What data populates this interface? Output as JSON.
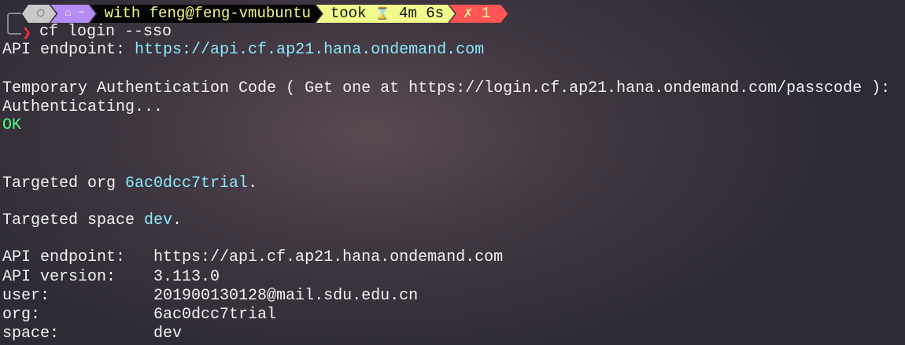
{
  "prompt": {
    "os_icon": "ubuntu-icon",
    "home_icon": "home-icon",
    "dir": "~",
    "user_host": "with feng@feng-vmubuntu",
    "took_label": "took",
    "hourglass_icon": "⌛",
    "duration": "4m 6s",
    "status_icon": "✗",
    "exit_code": "1",
    "chevron": "❯",
    "command": "cf login --sso"
  },
  "output": {
    "api_endpoint_label": "API endpoint: ",
    "api_endpoint_url": "https://api.cf.ap21.hana.ondemand.com",
    "temp_auth": "Temporary Authentication Code ( Get one at https://login.cf.ap21.hana.ondemand.com/passcode ):",
    "authenticating": "Authenticating...",
    "ok": "OK",
    "targeted_org_label": "Targeted org ",
    "targeted_org_value": "6ac0dcc7trial",
    "targeted_space_label": "Targeted space ",
    "targeted_space_value": "dev",
    "period": "."
  },
  "summary": [
    {
      "label": "API endpoint:   ",
      "value": "https://api.cf.ap21.hana.ondemand.com"
    },
    {
      "label": "API version:    ",
      "value": "3.113.0"
    },
    {
      "label": "user:           ",
      "value": "201900130128@mail.sdu.edu.cn"
    },
    {
      "label": "org:            ",
      "value": "6ac0dcc7trial"
    },
    {
      "label": "space:          ",
      "value": "dev"
    }
  ]
}
